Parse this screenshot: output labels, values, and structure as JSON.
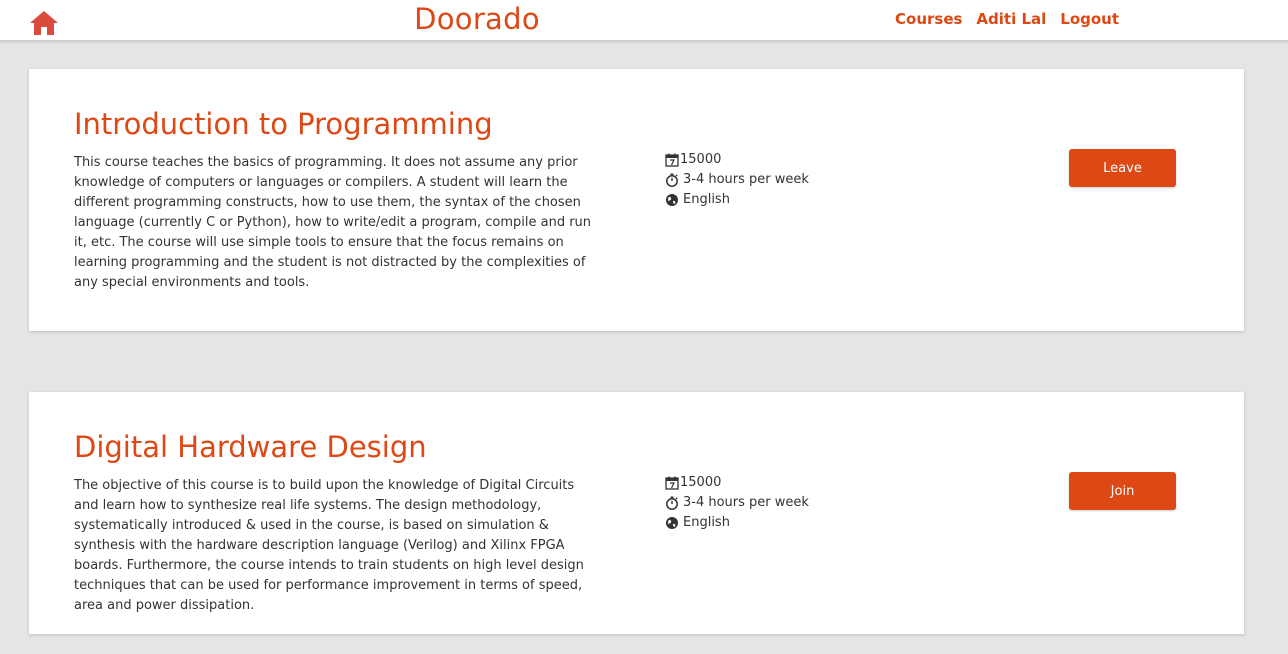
{
  "nav": {
    "brand": "Doorado",
    "links": [
      "Courses",
      "Aditi Lal",
      "Logout"
    ]
  },
  "courses": [
    {
      "title": "Introduction to Programming",
      "description": "This course teaches the basics of programming. It does not assume any prior knowledge of computers or languages or compilers. A student will learn the different programming constructs, how to use them, the syntax of the chosen language (currently C or Python), how to write/edit a program, compile and run it, etc. The course will use simple tools to ensure that the focus remains on learning programming and the student is not distracted by the complexities of any special environments and tools.",
      "fee": "15000",
      "duration": "3-4 hours per week",
      "language": "English",
      "action": "Leave"
    },
    {
      "title": "Digital Hardware Design",
      "description": "The objective of this course is to build upon the knowledge of Digital Circuits and learn how to synthesize real life systems. The design methodology, systematically introduced & used in the course, is based on simulation & synthesis with the hardware description language (Verilog) and Xilinx FPGA boards. Furthermore, the course intends to train students on high level design techniques that can be used for performance improvement in terms of speed, area and power dissipation.",
      "fee": "15000",
      "duration": "3-4 hours per week",
      "language": "English",
      "action": "Join"
    }
  ],
  "colors": {
    "accent": "#dd4814",
    "background": "#e5e5e5",
    "card": "#ffffff",
    "text": "#333333"
  },
  "icons": [
    "home-icon",
    "calendar-icon",
    "stopwatch-icon",
    "globe-icon"
  ]
}
